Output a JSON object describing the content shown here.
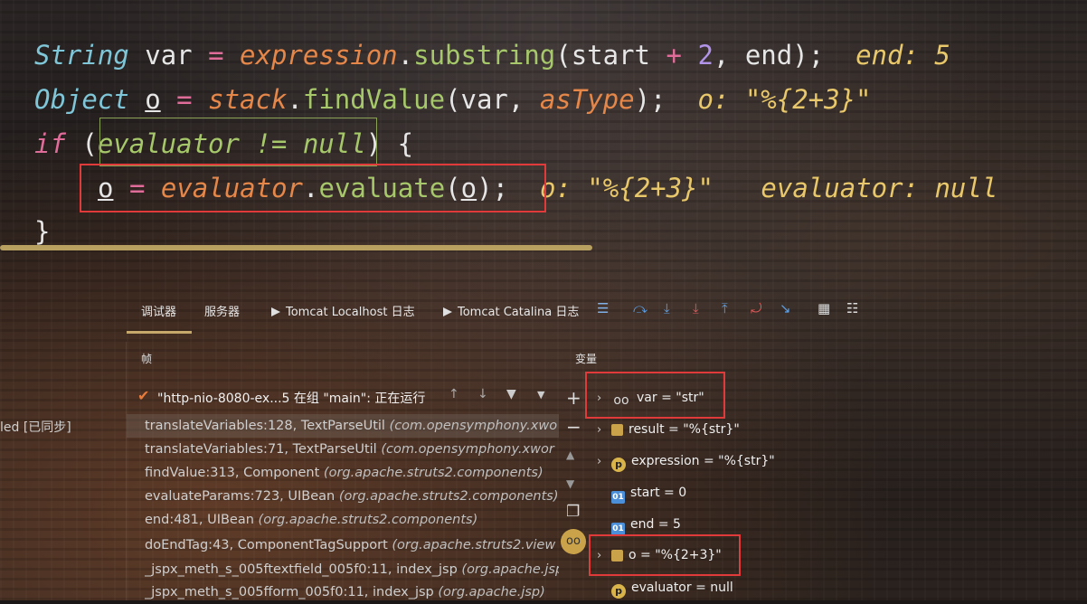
{
  "code": {
    "line1": {
      "kw": "String",
      "var": "var",
      "eq": "=",
      "obj": "expression",
      "dot": ".",
      "method": "substring",
      "open": "(",
      "arg1": "start",
      "plus": "+",
      "num": "2",
      "comma": ",",
      "arg2": "end",
      "close": ");",
      "hint": "end: 5"
    },
    "line2": {
      "kw": "Object",
      "var": "o",
      "eq": "=",
      "obj": "stack",
      "dot": ".",
      "method": "findValue",
      "open": "(",
      "arg1": "var",
      "comma": ",",
      "arg2": "asType",
      "close": ");",
      "hint": "o: \"%{2+3}\""
    },
    "line3": {
      "kw": "if",
      "open": " (",
      "cond": "evaluator != null",
      "close": ") {"
    },
    "line4": {
      "var": "o",
      "eq": "=",
      "obj": "evaluator",
      "dot": ".",
      "method": "evaluate",
      "open": "(",
      "arg": "o",
      "close": ");",
      "hint1": "o: \"%{2+3}\"",
      "hint2": "evaluator: null"
    },
    "line5": {
      "brace": "}"
    }
  },
  "tabs": [
    {
      "label": "调试器",
      "active": true
    },
    {
      "label": "服务器"
    },
    {
      "label": "Tomcat Localhost 日志"
    },
    {
      "label": "Tomcat Catalina 日志"
    }
  ],
  "toolbar_icons": [
    "menu-icon",
    "step-over-icon",
    "step-into-icon",
    "force-step-into-icon",
    "step-out-icon",
    "drop-frame-icon",
    "run-to-cursor-icon",
    "evaluate-icon",
    "trace-icon"
  ],
  "frames_panel": {
    "label": "帧",
    "thread": "\"http-nio-8080-ex...5 在组 \"main\": 正在运行",
    "rows": [
      {
        "method": "translateVariables:128, TextParseUtil",
        "pkg": "(com.opensymphony.xwo"
      },
      {
        "method": "translateVariables:71, TextParseUtil",
        "pkg": "(com.opensymphony.xwor"
      },
      {
        "method": "findValue:313, Component",
        "pkg": "(org.apache.struts2.components)"
      },
      {
        "method": "evaluateParams:723, UIBean",
        "pkg": "(org.apache.struts2.components)"
      },
      {
        "method": "end:481, UIBean",
        "pkg": "(org.apache.struts2.components)"
      },
      {
        "method": "doEndTag:43, ComponentTagSupport",
        "pkg": "(org.apache.struts2.view"
      },
      {
        "method": "_jspx_meth_s_005ftextfield_005f0:11, index_jsp",
        "pkg": "(org.apache.jsp)"
      },
      {
        "method": "_jspx_meth_s_005fform_005f0:11, index_jsp",
        "pkg": "(org.apache.jsp)"
      }
    ]
  },
  "left_fragment": "led [已同步]",
  "variables_panel": {
    "label": "变量",
    "rows": [
      {
        "icon": "watch",
        "text": "var = \"str\"",
        "expandable": true
      },
      {
        "icon": "list",
        "text": "result = \"%{str}\"",
        "expandable": true
      },
      {
        "icon": "p",
        "text": "expression = \"%{str}\"",
        "expandable": true
      },
      {
        "icon": "01",
        "text": "start = 0",
        "expandable": false
      },
      {
        "icon": "01",
        "text": "end = 5",
        "expandable": false
      },
      {
        "icon": "list",
        "text": "o = \"%{2+3}\"",
        "expandable": true
      },
      {
        "icon": "p",
        "text": "evaluator = null",
        "expandable": false
      }
    ]
  },
  "icons": {
    "p": "p",
    "01": "01"
  },
  "colors": {
    "accent": "#c7a86b",
    "highlight_box": "#e03a3a",
    "watch_box": "#8aa356"
  }
}
